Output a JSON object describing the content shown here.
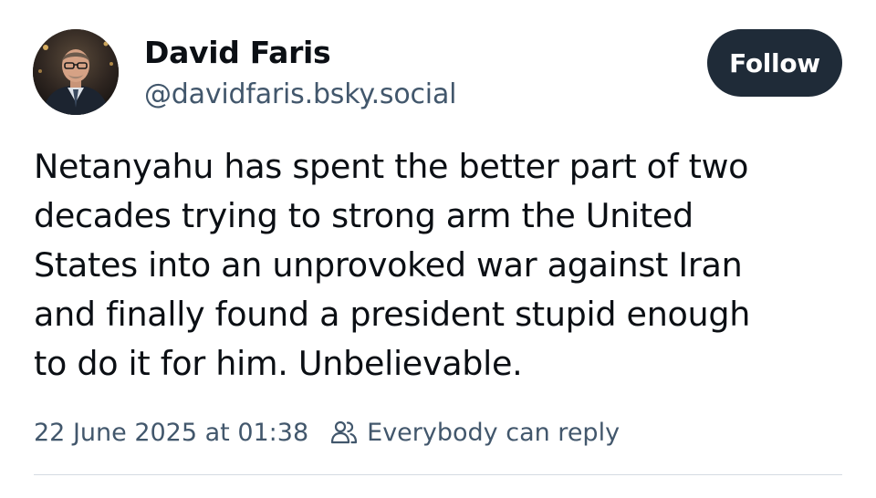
{
  "author": {
    "display_name": "David Faris",
    "handle": "@davidfaris.bsky.social",
    "avatar_icon": "user-avatar-photo"
  },
  "follow_button": {
    "label": "Follow",
    "color": "#1f2b38"
  },
  "post": {
    "text_lines": [
      "Netanyahu has spent the better part of two",
      "decades trying to strong arm the United",
      "States into an unprovoked war against Iran",
      "and finally found a president stupid enough",
      "to do it for him. Unbelievable."
    ],
    "timestamp": "22 June 2025 at 01:38",
    "reply_setting": "Everybody can reply",
    "reply_icon": "people-icon"
  },
  "colors": {
    "text": "#0b0f14",
    "muted": "#42576c",
    "divider": "#d4dbe2"
  }
}
